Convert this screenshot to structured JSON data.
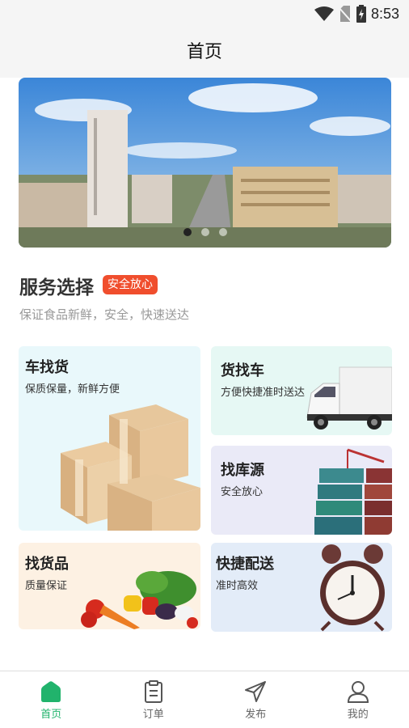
{
  "status_bar": {
    "time": "8:53"
  },
  "header": {
    "title": "首页"
  },
  "banner": {
    "slide_count": 3,
    "active_index": 0
  },
  "service": {
    "title": "服务选择",
    "badge": "安全放心",
    "subtitle": "保证食品新鲜，安全，快速送达"
  },
  "cards": [
    {
      "title": "车找货",
      "subtitle": "保质保量，新鲜方便"
    },
    {
      "title": "货找车",
      "subtitle": "方便快捷准时送达"
    },
    {
      "title": "找库源",
      "subtitle": "安全放心"
    },
    {
      "title": "找货品",
      "subtitle": "质量保证"
    },
    {
      "title": "快捷配送",
      "subtitle": "准时高效"
    }
  ],
  "nav": [
    {
      "label": "首页",
      "icon": "home-icon"
    },
    {
      "label": "订单",
      "icon": "clipboard-icon"
    },
    {
      "label": "发布",
      "icon": "paper-plane-icon"
    },
    {
      "label": "我的",
      "icon": "user-icon"
    }
  ],
  "colors": {
    "accent": "#21b36c",
    "badge": "#f04e2d"
  }
}
